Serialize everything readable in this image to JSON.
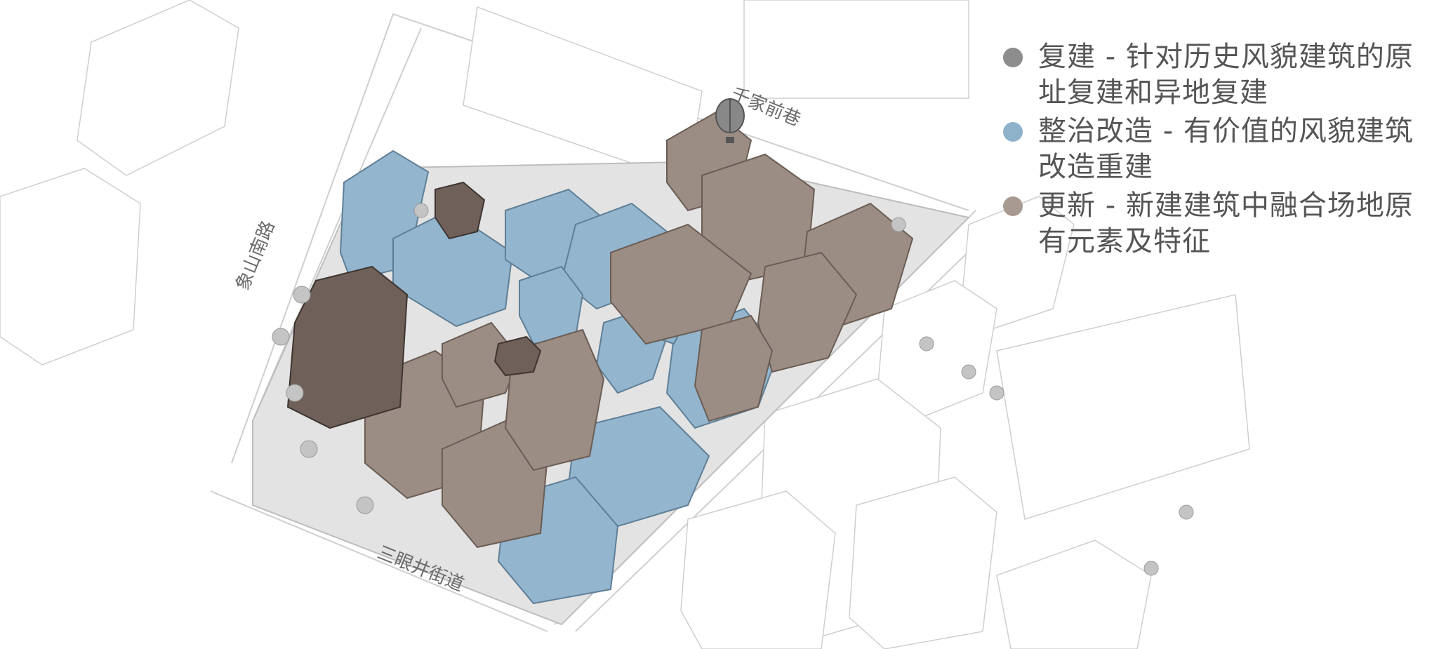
{
  "colors": {
    "reconstruction": "#8c8c8c",
    "renovation": "#8fb2cb",
    "renewal": "#a89a90",
    "reconstruction_building": "#6f615a",
    "renovation_building": "#93b5ce",
    "renewal_building": "#9b8d83",
    "context_building": "#ffffff",
    "ground": "#d9d9d9"
  },
  "legend": [
    {
      "key": "reconstruction",
      "text": "复建 - 针对历史风貌建筑的原址复建和异地复建"
    },
    {
      "key": "renovation",
      "text": "整治改造 - 有价值的风貌建筑改造重建"
    },
    {
      "key": "renewal",
      "text": "更新 - 新建建筑中融合场地原有元素及特征"
    }
  ],
  "streets": {
    "north": "千家前巷",
    "west": "象山南路",
    "south": "三眼井街道"
  }
}
